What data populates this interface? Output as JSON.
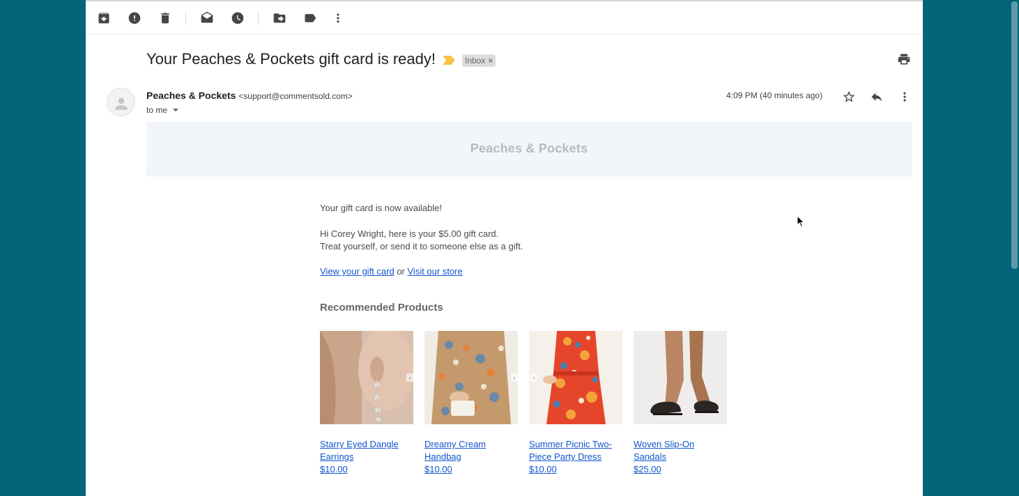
{
  "toolbar": {
    "buttons": [
      "archive-icon",
      "report-spam-icon",
      "delete-icon",
      "mark-unread-icon",
      "snooze-icon",
      "move-to-icon",
      "label-icon",
      "more-vert-icon"
    ]
  },
  "email": {
    "subject": "Your Peaches & Pockets gift card is ready!",
    "label_chip": "Inbox",
    "label_chip_close": "×",
    "sender_name": "Peaches & Pockets",
    "sender_email": "<support@commentsold.com>",
    "recipient": "to me",
    "timestamp": "4:09 PM (40 minutes ago)"
  },
  "body": {
    "banner_title": "Peaches & Pockets",
    "line1": "Your gift card is now available!",
    "line2": "Hi Corey Wright, here is your $5.00 gift card.",
    "line3": "Treat yourself, or send it to someone else as a gift.",
    "link_view": "View your gift card",
    "link_or": " or ",
    "link_store": "Visit our store",
    "recommended_title": "Recommended Products",
    "products": [
      {
        "name": "Starry Eyed Dangle Earrings",
        "price": "$10.00"
      },
      {
        "name": "Dreamy Cream Handbag",
        "price": "$10.00"
      },
      {
        "name": "Summer Picnic Two-Piece Party Dress",
        "price": "$10.00"
      },
      {
        "name": "Woven Slip-On Sandals",
        "price": "$25.00"
      }
    ]
  },
  "colors": {
    "desktop_bg": "#04657a",
    "link": "#1155cc",
    "importance_marker": "#f6c343",
    "banner_bg": "#f2f5fa"
  }
}
